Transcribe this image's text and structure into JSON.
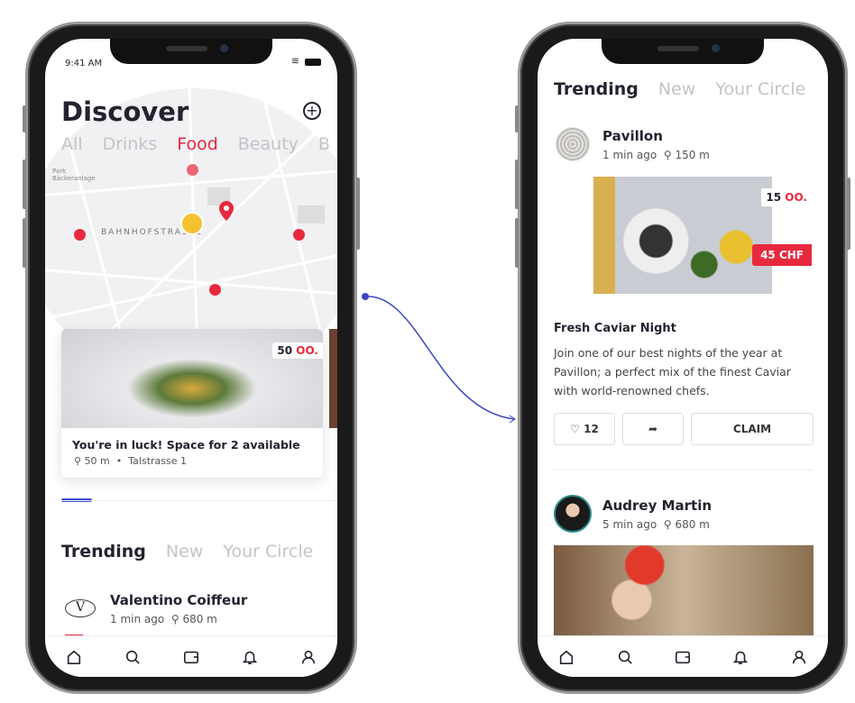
{
  "left_phone": {
    "status_time": "9:41 AM",
    "title": "Discover",
    "categories": [
      {
        "label": "All"
      },
      {
        "label": "Drinks"
      },
      {
        "label": "Food",
        "active": true
      },
      {
        "label": "Beauty"
      },
      {
        "label": "B"
      }
    ],
    "map": {
      "street_label": "BAHNHOFSTRASSE",
      "park_label": "Park Bäckeranlage"
    },
    "card": {
      "points": "50",
      "points_icon": "OO.",
      "title": "You're in luck! Space for 2 available",
      "distance": "50 m",
      "address": "Talstrasse 1"
    },
    "feed_tabs": [
      {
        "label": "Trending",
        "active": true
      },
      {
        "label": "New"
      },
      {
        "label": "Your Circle"
      }
    ],
    "post": {
      "author": "Valentino Coiffeur",
      "time": "1 min ago",
      "distance": "680 m",
      "logo": "V"
    }
  },
  "right_phone": {
    "feed_tabs": [
      {
        "label": "Trending",
        "active": true
      },
      {
        "label": "New"
      },
      {
        "label": "Your Circle"
      }
    ],
    "post1": {
      "author": "Pavillon",
      "time": "1 min ago",
      "distance": "150 m",
      "points": "15",
      "points_icon": "OO.",
      "price": "45 CHF",
      "title": "Fresh Caviar Night",
      "body": "Join one of our best nights of the year at Pavillon; a perfect mix of the finest Caviar with world-renowned chefs.",
      "likes": "12",
      "claim": "CLAIM"
    },
    "post2": {
      "author": "Audrey Martin",
      "time": "5 min ago",
      "distance": "680 m"
    }
  },
  "colors": {
    "accent": "#e8293d",
    "indicator": "#3a4fd0",
    "connector": "#3a47c4"
  },
  "nav_icons": [
    "home-icon",
    "search-icon",
    "wallet-icon",
    "bell-icon",
    "profile-icon"
  ]
}
